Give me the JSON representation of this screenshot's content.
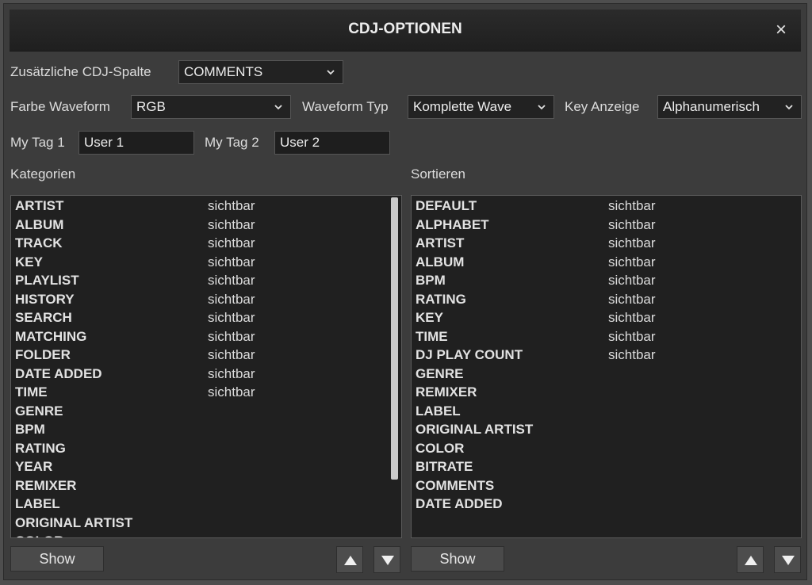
{
  "dialog": {
    "title": "CDJ-OPTIONEN",
    "close_glyph": "×"
  },
  "settings": {
    "extra_column": {
      "label": "Zusätzliche CDJ-Spalte",
      "value": "COMMENTS"
    },
    "waveform_color": {
      "label": "Farbe Waveform",
      "value": "RGB"
    },
    "waveform_type": {
      "label": "Waveform Typ",
      "value": "Komplette Wave"
    },
    "key_display": {
      "label": "Key Anzeige",
      "value": "Alphanumerisch"
    },
    "my_tag_1": {
      "label": "My Tag 1",
      "value": "User 1"
    },
    "my_tag_2": {
      "label": "My Tag 2",
      "value": "User 2"
    }
  },
  "categories": {
    "heading": "Kategorien",
    "items": [
      {
        "name": "ARTIST",
        "status": "sichtbar"
      },
      {
        "name": "ALBUM",
        "status": "sichtbar"
      },
      {
        "name": "TRACK",
        "status": "sichtbar"
      },
      {
        "name": "KEY",
        "status": "sichtbar"
      },
      {
        "name": "PLAYLIST",
        "status": "sichtbar"
      },
      {
        "name": "HISTORY",
        "status": "sichtbar"
      },
      {
        "name": "SEARCH",
        "status": "sichtbar"
      },
      {
        "name": "MATCHING",
        "status": "sichtbar"
      },
      {
        "name": "FOLDER",
        "status": "sichtbar"
      },
      {
        "name": "DATE ADDED",
        "status": "sichtbar"
      },
      {
        "name": "TIME",
        "status": "sichtbar"
      },
      {
        "name": "GENRE",
        "status": ""
      },
      {
        "name": "BPM",
        "status": ""
      },
      {
        "name": "RATING",
        "status": ""
      },
      {
        "name": "YEAR",
        "status": ""
      },
      {
        "name": "REMIXER",
        "status": ""
      },
      {
        "name": "LABEL",
        "status": ""
      },
      {
        "name": "ORIGINAL ARTIST",
        "status": ""
      },
      {
        "name": "COLOR",
        "status": ""
      }
    ],
    "show_label": "Show"
  },
  "sorting": {
    "heading": "Sortieren",
    "items": [
      {
        "name": "DEFAULT",
        "status": "sichtbar"
      },
      {
        "name": "ALPHABET",
        "status": "sichtbar"
      },
      {
        "name": "ARTIST",
        "status": "sichtbar"
      },
      {
        "name": "ALBUM",
        "status": "sichtbar"
      },
      {
        "name": "BPM",
        "status": "sichtbar"
      },
      {
        "name": "RATING",
        "status": "sichtbar"
      },
      {
        "name": "KEY",
        "status": "sichtbar"
      },
      {
        "name": "TIME",
        "status": "sichtbar"
      },
      {
        "name": "DJ PLAY COUNT",
        "status": "sichtbar"
      },
      {
        "name": "GENRE",
        "status": ""
      },
      {
        "name": "REMIXER",
        "status": ""
      },
      {
        "name": "LABEL",
        "status": ""
      },
      {
        "name": "ORIGINAL ARTIST",
        "status": ""
      },
      {
        "name": "COLOR",
        "status": ""
      },
      {
        "name": "BITRATE",
        "status": ""
      },
      {
        "name": "COMMENTS",
        "status": ""
      },
      {
        "name": "DATE ADDED",
        "status": ""
      }
    ],
    "show_label": "Show"
  },
  "icons": {
    "dropdown": "chevron-down-icon",
    "move_up": "triangle-up-icon",
    "move_down": "triangle-down-icon",
    "close": "close-icon"
  }
}
